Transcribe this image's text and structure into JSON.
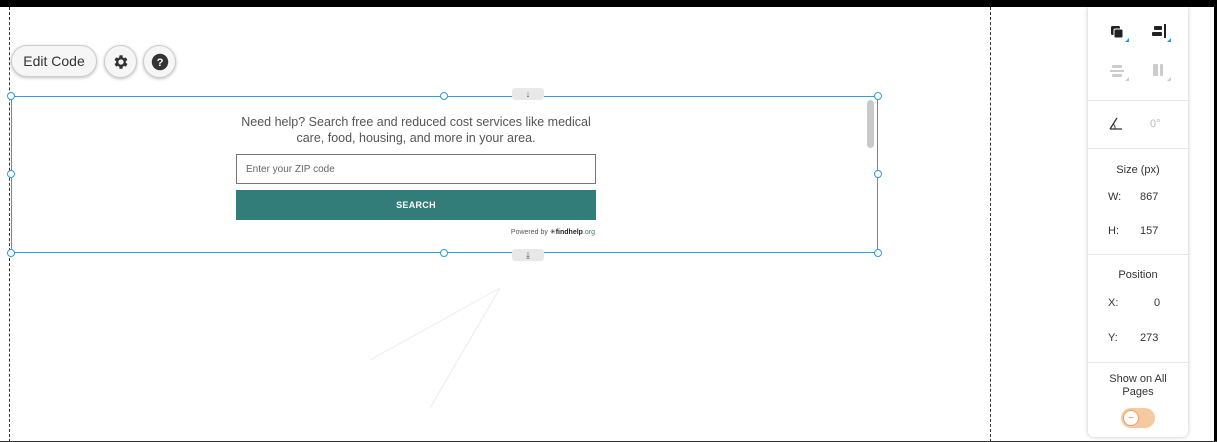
{
  "toolbar": {
    "edit_code_label": "Edit Code",
    "settings_icon": "gear-icon",
    "help_icon": "question-icon"
  },
  "widget": {
    "intro": "Need help? Search free and reduced cost services like medical care, food, housing, and more in your area.",
    "zip_placeholder": "Enter your ZIP code",
    "search_label": "SEARCH",
    "powered_by": "Powered by",
    "brand_name": "findhelp",
    "brand_tld": ".org",
    "accent_color": "#327d7a"
  },
  "panel": {
    "rotation": "0°",
    "size_title": "Size (px)",
    "w_label": "W:",
    "w_value": "867",
    "h_label": "H:",
    "h_value": "157",
    "position_title": "Position",
    "x_label": "X:",
    "x_value": "0",
    "y_label": "Y:",
    "y_value": "273",
    "show_all_label": "Show on All Pages",
    "toggle_on": false
  }
}
